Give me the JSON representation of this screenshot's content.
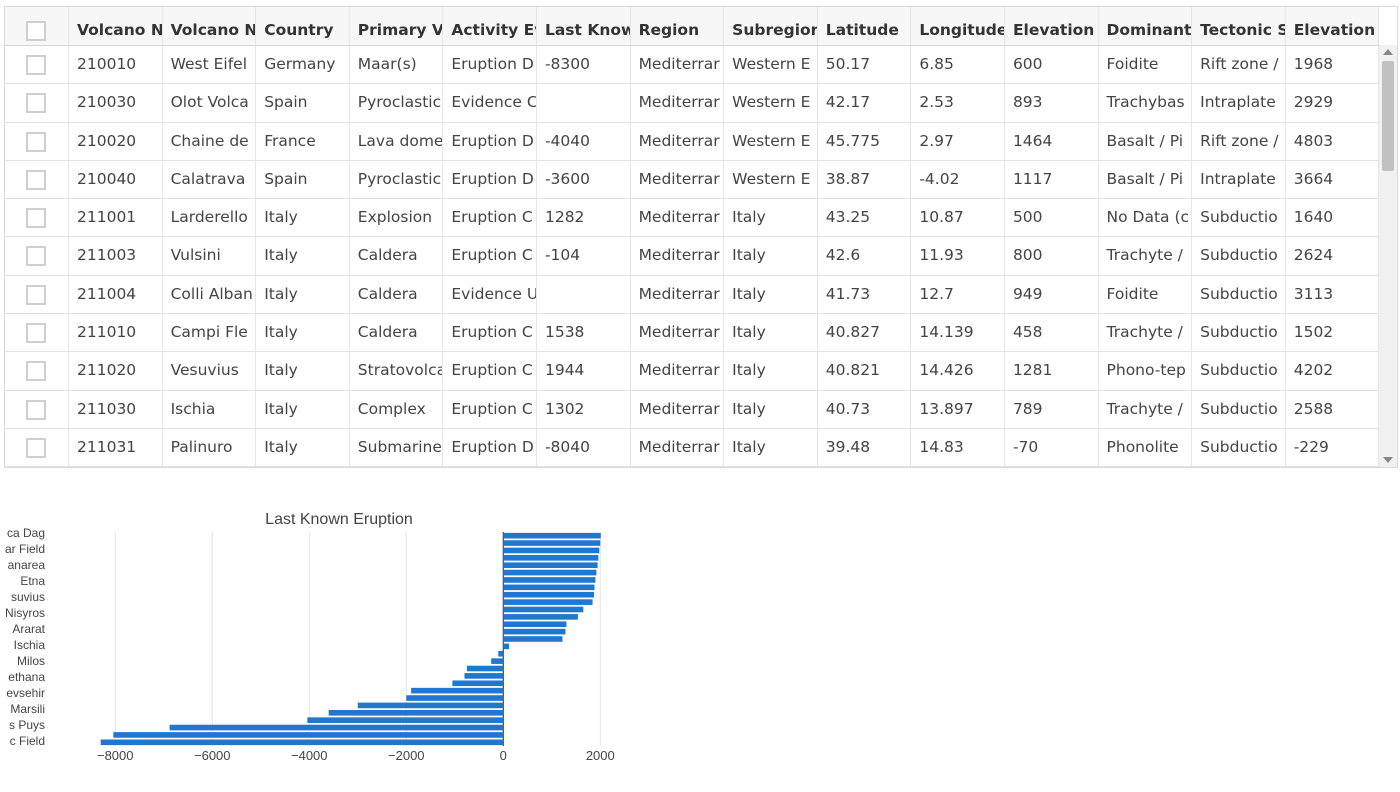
{
  "grid": {
    "headers": [
      "Volcano Nu",
      "Volcano Na",
      "Country",
      "Primary Vol",
      "Activity Evic",
      "Last Known",
      "Region",
      "Subregion",
      "Latitude",
      "Longitude",
      "Elevation (r",
      "Dominant R",
      "Tectonic Se",
      "Elevation (ft"
    ],
    "rows": [
      [
        "210010",
        "West Eifel",
        "Germany",
        "Maar(s)",
        "Eruption D",
        "-8300",
        "Mediterrar",
        "Western E",
        "50.17",
        "6.85",
        "600",
        "Foidite",
        "Rift zone /",
        "1968"
      ],
      [
        "210030",
        "Olot Volca",
        "Spain",
        "Pyroclastic",
        "Evidence C",
        "",
        "Mediterrar",
        "Western E",
        "42.17",
        "2.53",
        "893",
        "Trachybas",
        "Intraplate",
        "2929"
      ],
      [
        "210020",
        "Chaine de",
        "France",
        "Lava dome",
        "Eruption D",
        "-4040",
        "Mediterrar",
        "Western E",
        "45.775",
        "2.97",
        "1464",
        "Basalt / Pi",
        "Rift zone /",
        "4803"
      ],
      [
        "210040",
        "Calatrava",
        "Spain",
        "Pyroclastic",
        "Eruption D",
        "-3600",
        "Mediterrar",
        "Western E",
        "38.87",
        "-4.02",
        "1117",
        "Basalt / Pi",
        "Intraplate",
        "3664"
      ],
      [
        "211001",
        "Larderello",
        "Italy",
        "Explosion",
        "Eruption C",
        "1282",
        "Mediterrar",
        "Italy",
        "43.25",
        "10.87",
        "500",
        "No Data (c",
        "Subductio",
        "1640"
      ],
      [
        "211003",
        "Vulsini",
        "Italy",
        "Caldera",
        "Eruption C",
        "-104",
        "Mediterrar",
        "Italy",
        "42.6",
        "11.93",
        "800",
        "Trachyte /",
        "Subductio",
        "2624"
      ],
      [
        "211004",
        "Colli Alban",
        "Italy",
        "Caldera",
        "Evidence U",
        "",
        "Mediterrar",
        "Italy",
        "41.73",
        "12.7",
        "949",
        "Foidite",
        "Subductio",
        "3113"
      ],
      [
        "211010",
        "Campi Fle",
        "Italy",
        "Caldera",
        "Eruption C",
        "1538",
        "Mediterrar",
        "Italy",
        "40.827",
        "14.139",
        "458",
        "Trachyte /",
        "Subductio",
        "1502"
      ],
      [
        "211020",
        "Vesuvius",
        "Italy",
        "Stratovolca",
        "Eruption C",
        "1944",
        "Mediterrar",
        "Italy",
        "40.821",
        "14.426",
        "1281",
        "Phono-tep",
        "Subductio",
        "4202"
      ],
      [
        "211030",
        "Ischia",
        "Italy",
        "Complex",
        "Eruption C",
        "1302",
        "Mediterrar",
        "Italy",
        "40.73",
        "13.897",
        "789",
        "Trachyte /",
        "Subductio",
        "2588"
      ],
      [
        "211031",
        "Palinuro",
        "Italy",
        "Submarine",
        "Eruption D",
        "-8040",
        "Mediterrar",
        "Italy",
        "39.48",
        "14.83",
        "-70",
        "Phonolite",
        "Subductio",
        "-229"
      ]
    ]
  },
  "chart_data": {
    "type": "bar",
    "orientation": "horizontal",
    "title": "Last Known Eruption",
    "xlim": [
      -8500,
      2200
    ],
    "xticks": [
      -8000,
      -6000,
      -4000,
      -2000,
      0,
      2000
    ],
    "xtick_labels": [
      "−8000",
      "−6000",
      "−4000",
      "−2000",
      "0",
      "2000"
    ],
    "ytick_labels": [
      "c Field",
      "s Puys",
      "Marsili",
      "evsehir",
      "ethana",
      "Milos",
      "Ischia",
      "Ararat",
      "Nisyros",
      "suvius",
      "Etna",
      "anarea",
      "ar Field",
      "ca Dag"
    ],
    "values": [
      -8300,
      -8040,
      -6880,
      -4040,
      -3600,
      -3000,
      -2000,
      -1900,
      -1050,
      -800,
      -750,
      -250,
      -104,
      120,
      1220,
      1282,
      1302,
      1538,
      1650,
      1840,
      1870,
      1880,
      1900,
      1920,
      1944,
      1960,
      1980,
      2000,
      2010
    ],
    "color": "#1f77d0"
  }
}
